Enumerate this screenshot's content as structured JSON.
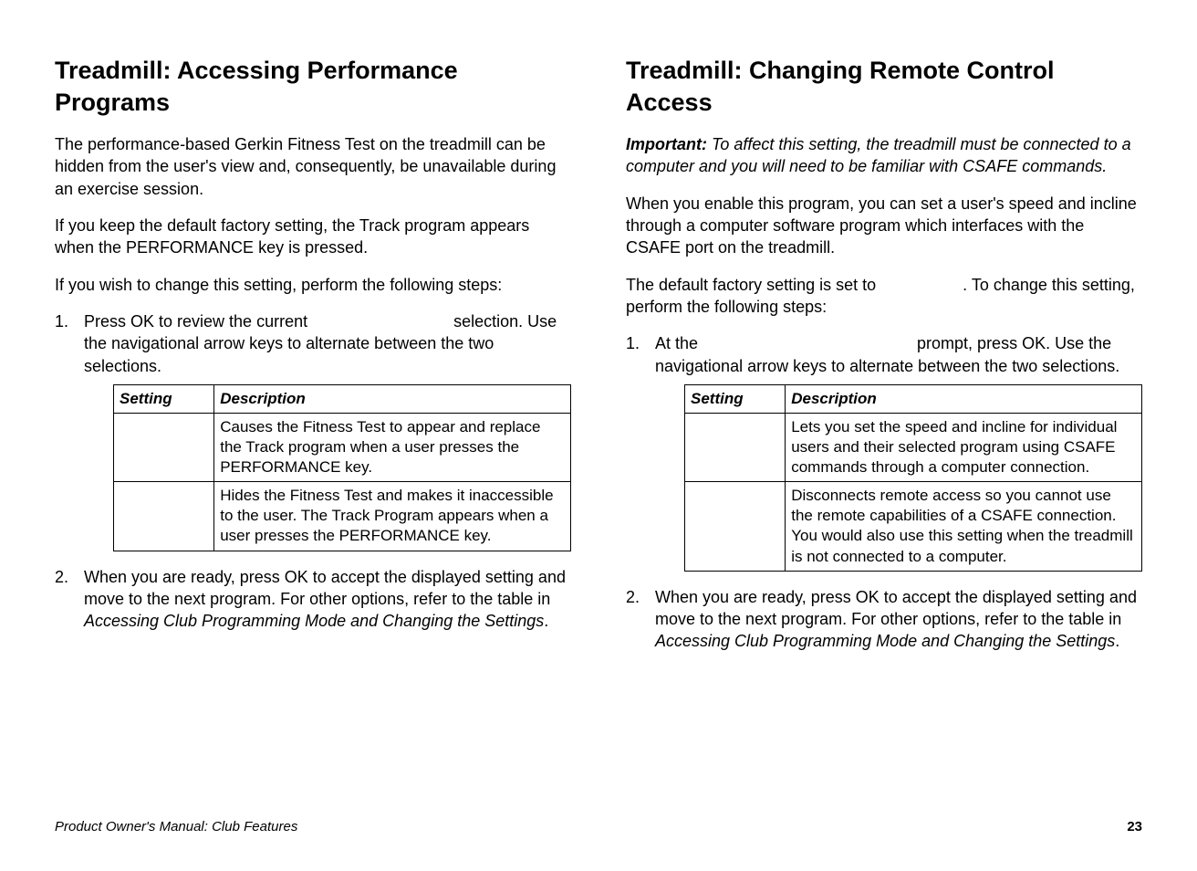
{
  "left": {
    "heading": "Treadmill: Accessing Performance Programs",
    "p1": "The performance-based Gerkin Fitness Test on the treadmill can be hidden from the user's view and, consequently, be unavailable during an exercise session.",
    "p2": "If you keep the default factory setting, the Track program appears when the PERFORMANCE key is pressed.",
    "p3": "If you wish to change this setting, perform the following steps:",
    "step1a": "Press OK to review the current ",
    "step1b": " selection. Use the navigational arrow keys to alternate between the two selections.",
    "table": {
      "h1": "Setting",
      "h2": "Description",
      "r1c1": "",
      "r1c2": "Causes the Fitness Test to appear and replace the Track program when a user presses the PERFORMANCE key.",
      "r2c1": "",
      "r2c2": "Hides the Fitness Test and makes it inaccessible to the user. The Track Program appears when a user presses the PERFORMANCE key."
    },
    "step2a": "When you are ready, press OK to accept the displayed setting and move to the next program. For other options, refer to the table in ",
    "step2b": "Accessing Club Programming Mode and Changing the Settings",
    "step2c": "."
  },
  "right": {
    "heading": "Treadmill: Changing Remote Control Access",
    "important_label": "Important:",
    "important_text": " To affect this setting, the treadmill must be connected to a computer and you will need to be familiar with CSAFE commands.",
    "p1": "When you enable this program, you can set a user's speed and incline through a computer software program which interfaces with the CSAFE port on the treadmill.",
    "p2a": "The default factory setting is set to ",
    "p2b": ". To change this setting, perform the following steps:",
    "step1a": "At the ",
    "step1b": " prompt, press OK. Use the navigational arrow keys to alternate between the two selections.",
    "table": {
      "h1": "Setting",
      "h2": "Description",
      "r1c1": "",
      "r1c2": "Lets you set the speed and incline for individual users and their selected program using CSAFE commands through a computer connection.",
      "r2c1": "",
      "r2c2": "Disconnects remote access so you cannot use the remote capabilities of a CSAFE connection. You would also use this setting when the treadmill is not connected to a computer."
    },
    "step2a": "When you are ready, press OK to accept the displayed setting and move to the next program. For other options, refer to the table in ",
    "step2b": "Accessing Club Programming Mode and Changing the Settings",
    "step2c": "."
  },
  "footer": {
    "left": "Product Owner's Manual: Club Features",
    "page": "23"
  }
}
